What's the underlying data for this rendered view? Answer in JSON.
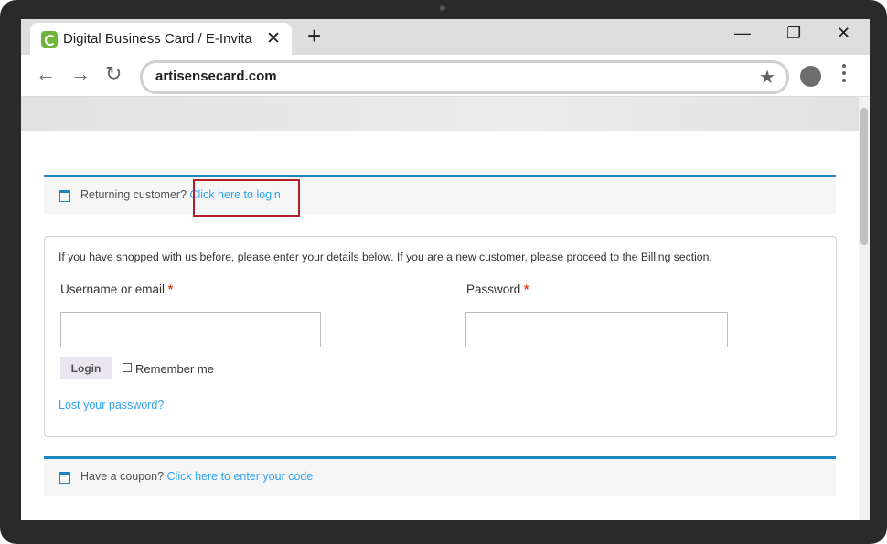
{
  "browser": {
    "tab_title": "Digital Business Card / E-Invita",
    "tab_close": "✕",
    "new_tab": "+",
    "window_controls": {
      "minimize": "—",
      "restore": "❐",
      "close": "✕"
    },
    "nav": {
      "back": "←",
      "forward": "→",
      "reload": "↻"
    },
    "url": "artisensecard.com",
    "bookmark_star": "★",
    "icons": {
      "favicon": "site-favicon-icon",
      "profile": "profile-avatar-icon",
      "menu": "kebab-menu-icon"
    }
  },
  "checkout": {
    "returning": {
      "prefix": "Returning customer?",
      "link": " Click here to login"
    },
    "login": {
      "intro": "If you have shopped with us before, please enter your details below. If you are a new customer, please proceed to the Billing section.",
      "username_label": "Username or email",
      "password_label": "Password",
      "required_mark": "*",
      "username_value": "",
      "password_value": "",
      "login_button": "Login",
      "remember_label": "Remember me",
      "lost_password": "Lost your password?"
    },
    "coupon": {
      "prefix": "Have a coupon?",
      "link": " Click here to enter your code"
    }
  },
  "colors": {
    "accent_blue": "#1e85be",
    "link": "#2ea3f2",
    "highlight_box": "#b21f2b",
    "required": "#e2401c",
    "favicon_green": "#6fb63b"
  }
}
